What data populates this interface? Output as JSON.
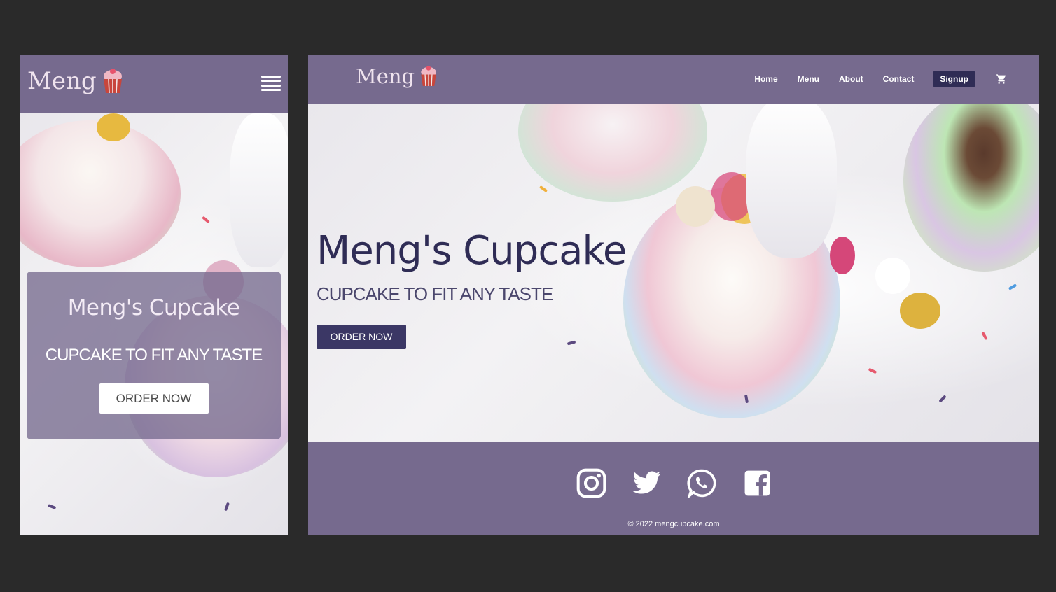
{
  "brand": {
    "logo_text": "Meng",
    "logo_icon": "cupcake-icon",
    "colors": {
      "header": "#766a8e",
      "dark_accent": "#2f2c55",
      "cup_red": "#c8463c"
    }
  },
  "mobile": {
    "menu_icon": "hamburger-menu-icon",
    "hero": {
      "title": "Meng's Cupcake",
      "subtitle": "CUPCAKE TO FIT ANY TASTE",
      "cta": "ORDER NOW"
    }
  },
  "desktop": {
    "nav": {
      "home": "Home",
      "menu": "Menu",
      "about": "About",
      "contact": "Contact",
      "signup": "Signup",
      "cart_icon": "cart-icon"
    },
    "hero": {
      "title": "Meng's Cupcake",
      "subtitle": "CUPCAKE TO FIT ANY TASTE",
      "cta": "ORDER NOW"
    },
    "footer": {
      "social_icons": [
        "instagram-icon",
        "twitter-icon",
        "whatsapp-icon",
        "facebook-icon"
      ],
      "copyright": "© 2022 mengcupcake.com"
    }
  }
}
